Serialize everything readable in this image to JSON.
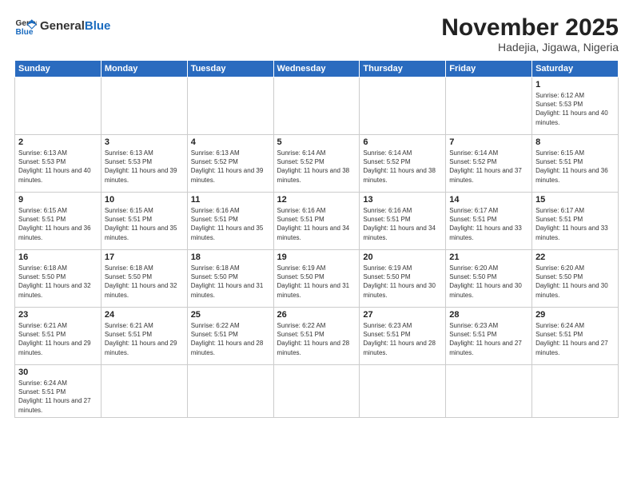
{
  "header": {
    "logo_general": "General",
    "logo_blue": "Blue",
    "month": "November 2025",
    "location": "Hadejia, Jigawa, Nigeria"
  },
  "weekdays": [
    "Sunday",
    "Monday",
    "Tuesday",
    "Wednesday",
    "Thursday",
    "Friday",
    "Saturday"
  ],
  "days": {
    "1": {
      "sunrise": "6:12 AM",
      "sunset": "5:53 PM",
      "daylight": "11 hours and 40 minutes."
    },
    "2": {
      "sunrise": "6:13 AM",
      "sunset": "5:53 PM",
      "daylight": "11 hours and 40 minutes."
    },
    "3": {
      "sunrise": "6:13 AM",
      "sunset": "5:53 PM",
      "daylight": "11 hours and 39 minutes."
    },
    "4": {
      "sunrise": "6:13 AM",
      "sunset": "5:52 PM",
      "daylight": "11 hours and 39 minutes."
    },
    "5": {
      "sunrise": "6:14 AM",
      "sunset": "5:52 PM",
      "daylight": "11 hours and 38 minutes."
    },
    "6": {
      "sunrise": "6:14 AM",
      "sunset": "5:52 PM",
      "daylight": "11 hours and 38 minutes."
    },
    "7": {
      "sunrise": "6:14 AM",
      "sunset": "5:52 PM",
      "daylight": "11 hours and 37 minutes."
    },
    "8": {
      "sunrise": "6:15 AM",
      "sunset": "5:51 PM",
      "daylight": "11 hours and 36 minutes."
    },
    "9": {
      "sunrise": "6:15 AM",
      "sunset": "5:51 PM",
      "daylight": "11 hours and 36 minutes."
    },
    "10": {
      "sunrise": "6:15 AM",
      "sunset": "5:51 PM",
      "daylight": "11 hours and 35 minutes."
    },
    "11": {
      "sunrise": "6:16 AM",
      "sunset": "5:51 PM",
      "daylight": "11 hours and 35 minutes."
    },
    "12": {
      "sunrise": "6:16 AM",
      "sunset": "5:51 PM",
      "daylight": "11 hours and 34 minutes."
    },
    "13": {
      "sunrise": "6:16 AM",
      "sunset": "5:51 PM",
      "daylight": "11 hours and 34 minutes."
    },
    "14": {
      "sunrise": "6:17 AM",
      "sunset": "5:51 PM",
      "daylight": "11 hours and 33 minutes."
    },
    "15": {
      "sunrise": "6:17 AM",
      "sunset": "5:51 PM",
      "daylight": "11 hours and 33 minutes."
    },
    "16": {
      "sunrise": "6:18 AM",
      "sunset": "5:50 PM",
      "daylight": "11 hours and 32 minutes."
    },
    "17": {
      "sunrise": "6:18 AM",
      "sunset": "5:50 PM",
      "daylight": "11 hours and 32 minutes."
    },
    "18": {
      "sunrise": "6:18 AM",
      "sunset": "5:50 PM",
      "daylight": "11 hours and 31 minutes."
    },
    "19": {
      "sunrise": "6:19 AM",
      "sunset": "5:50 PM",
      "daylight": "11 hours and 31 minutes."
    },
    "20": {
      "sunrise": "6:19 AM",
      "sunset": "5:50 PM",
      "daylight": "11 hours and 30 minutes."
    },
    "21": {
      "sunrise": "6:20 AM",
      "sunset": "5:50 PM",
      "daylight": "11 hours and 30 minutes."
    },
    "22": {
      "sunrise": "6:20 AM",
      "sunset": "5:50 PM",
      "daylight": "11 hours and 30 minutes."
    },
    "23": {
      "sunrise": "6:21 AM",
      "sunset": "5:51 PM",
      "daylight": "11 hours and 29 minutes."
    },
    "24": {
      "sunrise": "6:21 AM",
      "sunset": "5:51 PM",
      "daylight": "11 hours and 29 minutes."
    },
    "25": {
      "sunrise": "6:22 AM",
      "sunset": "5:51 PM",
      "daylight": "11 hours and 28 minutes."
    },
    "26": {
      "sunrise": "6:22 AM",
      "sunset": "5:51 PM",
      "daylight": "11 hours and 28 minutes."
    },
    "27": {
      "sunrise": "6:23 AM",
      "sunset": "5:51 PM",
      "daylight": "11 hours and 28 minutes."
    },
    "28": {
      "sunrise": "6:23 AM",
      "sunset": "5:51 PM",
      "daylight": "11 hours and 27 minutes."
    },
    "29": {
      "sunrise": "6:24 AM",
      "sunset": "5:51 PM",
      "daylight": "11 hours and 27 minutes."
    },
    "30": {
      "sunrise": "6:24 AM",
      "sunset": "5:51 PM",
      "daylight": "11 hours and 27 minutes."
    }
  }
}
